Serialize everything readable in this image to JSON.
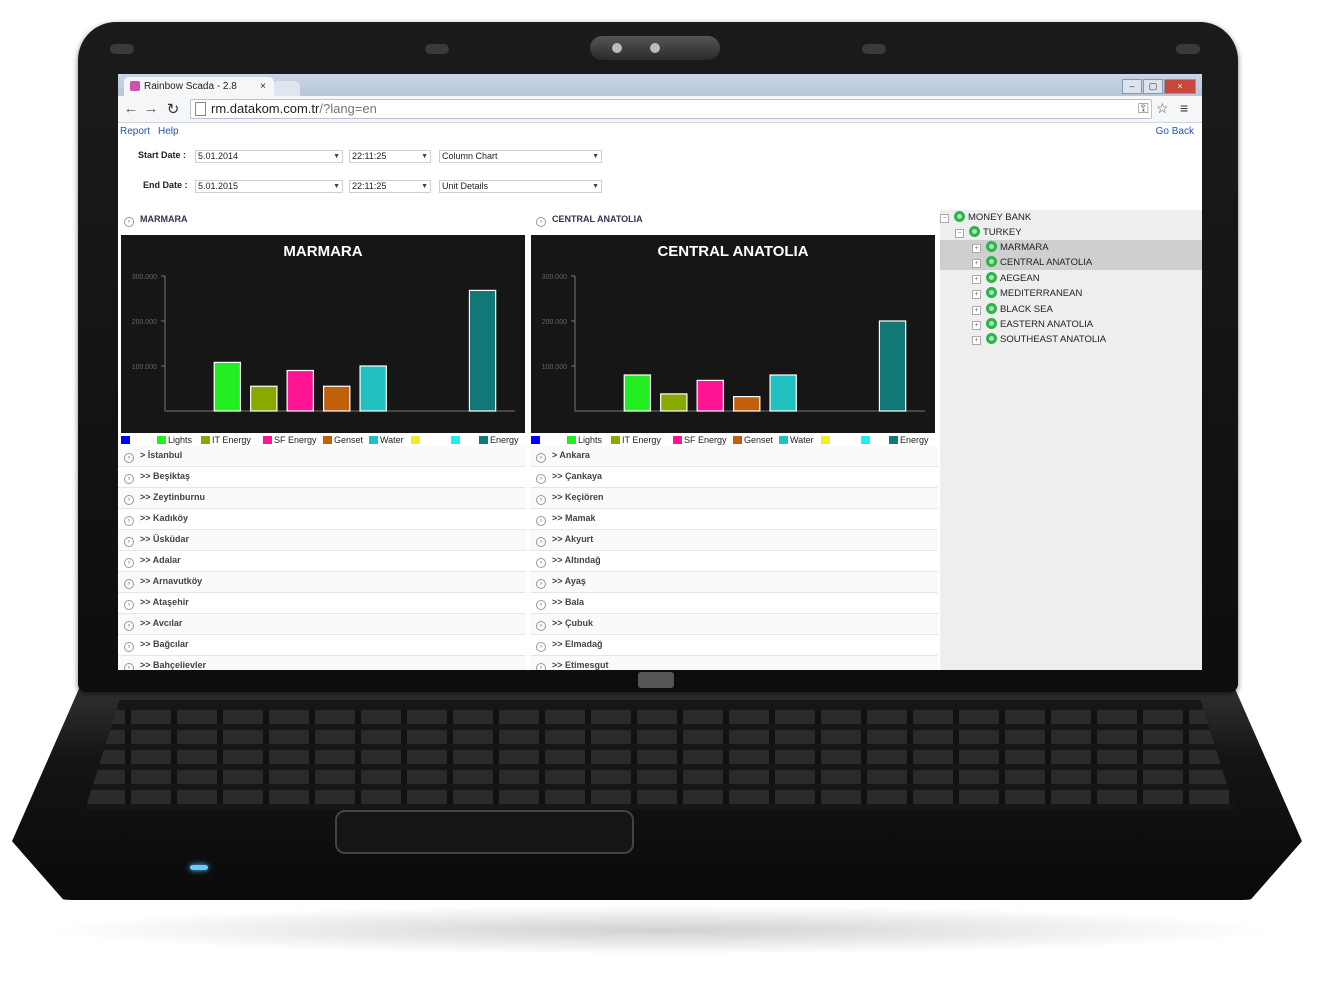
{
  "browser": {
    "tab_title": "Rainbow Scada - 2.8",
    "tab_close": "×",
    "url_host": "rm.datakom.com.tr",
    "url_path": "/?lang=en",
    "win_min": "–",
    "win_max": "▢",
    "win_close": "×"
  },
  "menu": {
    "report": "Report",
    "help": "Help",
    "go_back": "Go Back"
  },
  "filters": {
    "start_label": "Start Date :",
    "start_date": "5.01.2014",
    "start_time": "22:11:25",
    "chart_type": "Column Chart",
    "end_label": "End Date :",
    "end_date": "5.01.2015",
    "end_time": "22:11:25",
    "detail": "Unit Details"
  },
  "chart_data": [
    {
      "type": "bar",
      "title": "MARMARA",
      "categories": [
        "",
        "Lights",
        "IT Energy",
        "SF Energy",
        "Genset",
        "Water",
        "",
        "",
        "Energy"
      ],
      "values": [
        0,
        108000,
        55000,
        90000,
        55000,
        100000,
        0,
        0,
        268000
      ],
      "colors": [
        "#0000ff",
        "#22ee22",
        "#88aa00",
        "#ff1493",
        "#c0600a",
        "#22c0c0",
        "#eeee22",
        "#22eeee",
        "#117777"
      ],
      "ylim": [
        0,
        300000
      ],
      "yticks": [
        "100.000",
        "200.000",
        "300.000"
      ]
    },
    {
      "type": "bar",
      "title": "CENTRAL ANATOLIA",
      "categories": [
        "",
        "Lights",
        "IT Energy",
        "SF Energy",
        "Genset",
        "Water",
        "",
        "",
        "Energy"
      ],
      "values": [
        0,
        80000,
        38000,
        68000,
        32000,
        80000,
        0,
        0,
        200000
      ],
      "colors": [
        "#0000ff",
        "#22ee22",
        "#88aa00",
        "#ff1493",
        "#c0600a",
        "#22c0c0",
        "#eeee22",
        "#22eeee",
        "#117777"
      ],
      "ylim": [
        0,
        300000
      ],
      "yticks": [
        "100.000",
        "200.000",
        "300.000"
      ]
    }
  ],
  "left_panel": {
    "header": "MARMARA",
    "rows": [
      "> İstanbul",
      ">> Beşiktaş",
      ">> Zeytinburnu",
      ">> Kadıköy",
      ">> Üsküdar",
      ">> Adalar",
      ">> Arnavutköy",
      ">> Ataşehir",
      ">> Avcılar",
      ">> Bağcılar",
      ">> Bahçelievler"
    ]
  },
  "right_panel": {
    "header": "CENTRAL ANATOLIA",
    "rows": [
      "> Ankara",
      ">> Çankaya",
      ">> Keçiören",
      ">> Mamak",
      ">> Akyurt",
      ">> Altındağ",
      ">> Ayaş",
      ">> Bala",
      ">> Çubuk",
      ">> Elmadağ",
      ">> Etimesgut"
    ]
  },
  "tree": {
    "root": "MONEY BANK",
    "country": "TURKEY",
    "regions": [
      "MARMARA",
      "CENTRAL ANATOLIA",
      "AEGEAN",
      "MEDITERRANEAN",
      "BLACK SEA",
      "EASTERN ANATOLIA",
      "SOUTHEAST ANATOLIA"
    ]
  }
}
